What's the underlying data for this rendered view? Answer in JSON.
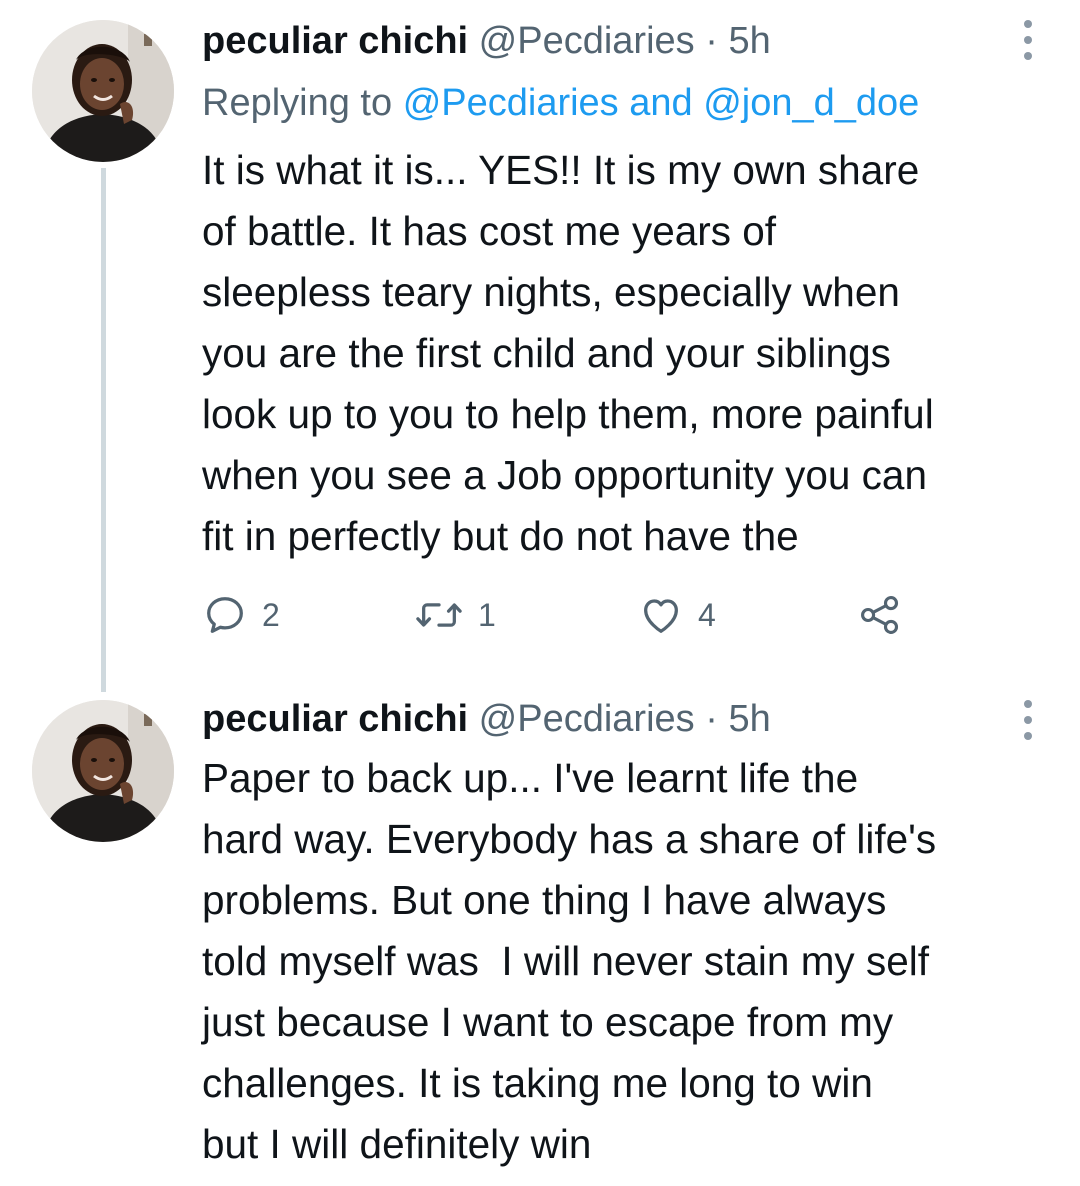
{
  "tweets": [
    {
      "name": "peculiar chichi",
      "handle": "@Pecdiaries",
      "separator": "·",
      "time": "5h",
      "replying_prefix": "Replying to",
      "replying_mention_1": "@Pecdiaries",
      "replying_and": "and",
      "replying_mention_2": "@jon_d_doe",
      "text_lines": [
        "It is what it is... YES!! It is my own share",
        "of battle. It has cost me years of",
        "sleepless teary nights, especially when",
        "you are the first child and your siblings",
        "look up to you to help them, more painful",
        "when you see a Job opportunity you can",
        "fit in perfectly but do not have the"
      ],
      "actions": {
        "reply_count": "2",
        "retweet_count": "1",
        "like_count": "4"
      }
    },
    {
      "name": "peculiar chichi",
      "handle": "@Pecdiaries",
      "separator": "·",
      "time": "5h",
      "text_lines": [
        "Paper to back up... I've learnt life the",
        "hard way. Everybody has a share of life's",
        "problems. But one thing I have always",
        "told myself was  I will never stain my self",
        "just because I want to escape from my",
        "challenges. It is taking me long to win",
        "but I will definitely win"
      ]
    }
  ],
  "icons": {
    "reply": "reply-bubble-icon",
    "retweet": "retweet-icon",
    "like": "heart-icon",
    "share": "share-icon",
    "more": "more-vertical-icon"
  },
  "colors": {
    "text": "#0f1419",
    "secondary": "#536471",
    "mention": "#1d9bf0",
    "thread_line": "#cfd9de"
  }
}
